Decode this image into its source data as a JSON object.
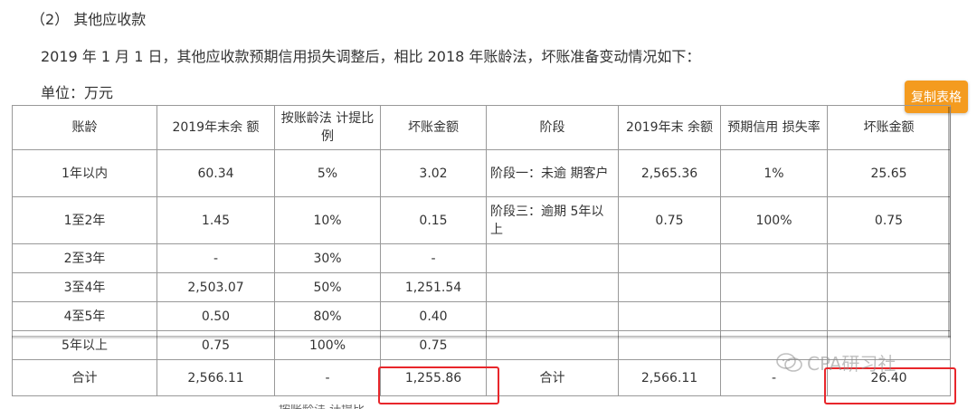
{
  "heading": "（2） 其他应收款",
  "intro": "2019 年 1 月 1 日，其他应收款预期信用损失调整后，相比 2018 年账龄法，坏账准备变动情况如下：",
  "unit": "单位：万元",
  "copy_button": "复制表格",
  "table": {
    "headers": [
      "账龄",
      "2019年末余 额",
      "按账龄法 计提比例",
      "坏账金额",
      "阶段",
      "2019年末 余额",
      "预期信用 损失率",
      "坏账金额"
    ],
    "rows": [
      [
        "1年以内",
        "60.34",
        "5%",
        "3.02",
        "阶段一：未逾 期客户",
        "2,565.36",
        "1%",
        "25.65"
      ],
      [
        "1至2年",
        "1.45",
        "10%",
        "0.15",
        "阶段三：逾期 5年以上",
        "0.75",
        "100%",
        "0.75"
      ],
      [
        "2至3年",
        "-",
        "30%",
        "-",
        "",
        "",
        "",
        ""
      ],
      [
        "3至4年",
        "2,503.07",
        "50%",
        "1,251.54",
        "",
        "",
        "",
        ""
      ],
      [
        "4至5年",
        "0.50",
        "80%",
        "0.40",
        "",
        "",
        "",
        ""
      ],
      [
        "5年以上",
        "0.75",
        "100%",
        "0.75",
        "",
        "",
        "",
        ""
      ],
      [
        "合计",
        "2,566.11",
        "-",
        "1,255.86",
        "合计",
        "2,566.11",
        "-",
        "26.40"
      ]
    ]
  },
  "watermark": "CPA研习社",
  "cut_off_text": "按账龄法 计提比"
}
